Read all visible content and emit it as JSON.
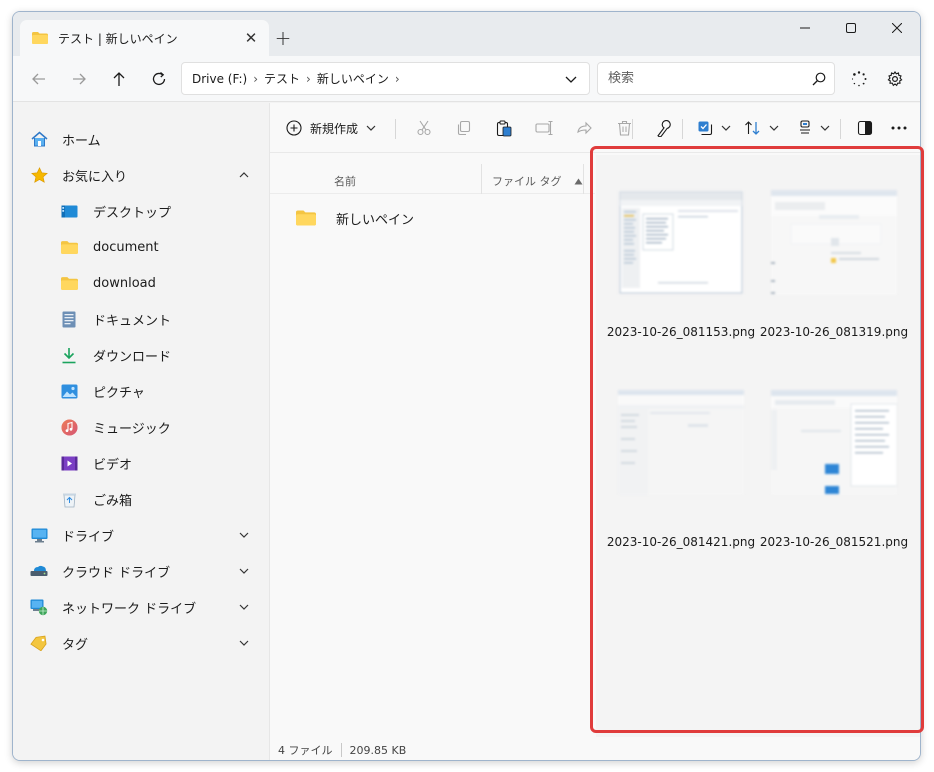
{
  "window": {
    "tab_title": "テスト | 新しいペイン",
    "tab_close_glyph": "✕",
    "new_tab_glyph": "+"
  },
  "address": {
    "crumbs": [
      "Drive (F:)",
      "テスト",
      "新しいペイン"
    ],
    "search_placeholder": "検索"
  },
  "sidebar": {
    "items": [
      {
        "label": "ホーム",
        "icon": "home-icon"
      },
      {
        "label": "お気に入り",
        "icon": "star-icon"
      },
      {
        "label": "デスクトップ",
        "icon": "desktop-icon"
      },
      {
        "label": "document",
        "icon": "folder-icon"
      },
      {
        "label": "download",
        "icon": "folder-icon"
      },
      {
        "label": "ドキュメント",
        "icon": "documents-icon"
      },
      {
        "label": "ダウンロード",
        "icon": "download-icon"
      },
      {
        "label": "ピクチャ",
        "icon": "pictures-icon"
      },
      {
        "label": "ミュージック",
        "icon": "music-icon"
      },
      {
        "label": "ビデオ",
        "icon": "video-icon"
      },
      {
        "label": "ごみ箱",
        "icon": "recycle-bin-icon"
      },
      {
        "label": "ドライブ",
        "icon": "drive-icon"
      },
      {
        "label": "クラウド ドライブ",
        "icon": "cloud-drive-icon"
      },
      {
        "label": "ネットワーク ドライブ",
        "icon": "network-drive-icon"
      },
      {
        "label": "タグ",
        "icon": "tag-icon"
      }
    ]
  },
  "toolbar": {
    "new_label": "新規作成"
  },
  "filelist": {
    "col_name": "名前",
    "col_tag": "ファイル タグ",
    "rows": [
      {
        "name": "新しいペイン",
        "icon": "folder-icon"
      }
    ]
  },
  "status": {
    "count": "4 ファイル",
    "size": "209.85 KB"
  },
  "preview": {
    "files": [
      "2023-10-26_081153.png",
      "2023-10-26_081319.png",
      "2023-10-26_081421.png",
      "2023-10-26_081521.png"
    ]
  },
  "colors": {
    "accent": "#0067c0",
    "highlight": "#e03c3c",
    "folder": "#f4c542"
  }
}
